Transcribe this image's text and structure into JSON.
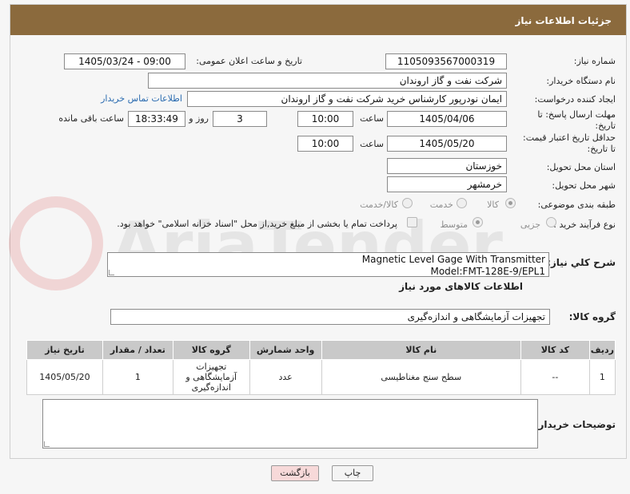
{
  "header": {
    "title": "جزئیات اطلاعات نیاز"
  },
  "fields": {
    "need_number_label": "شماره نیاز:",
    "need_number": "1105093567000319",
    "announce_label": "تاریخ و ساعت اعلان عمومی:",
    "announce_value": "1405/03/24 - 09:00",
    "buyer_org_label": "نام دستگاه خریدار:",
    "buyer_org": "شرکت نفت و گاز اروندان",
    "creator_label": "ایجاد کننده درخواست:",
    "creator": "ایمان نودرپور کارشناس خرید شرکت نفت و گاز اروندان",
    "contact_link": "اطلاعات تماس خریدار",
    "deadline_label_1": "مهلت ارسال پاسخ: تا",
    "deadline_label_2": "تاریخ:",
    "deadline_date": "1405/04/06",
    "time_label": "ساعت",
    "deadline_time": "10:00",
    "days_value": "3",
    "days_label": "روز و",
    "remaining_time": "18:33:49",
    "remaining_label": "ساعت باقی مانده",
    "validity_label_1": "حداقل تاریخ اعتبار قیمت:",
    "validity_label_2": "تا تاریخ:",
    "validity_date": "1405/05/20",
    "validity_time": "10:00",
    "province_label": "استان محل تحویل:",
    "province": "خوزستان",
    "city_label": "شهر محل تحویل:",
    "city": "خرمشهر",
    "category_label": "طبقه بندی موضوعی:",
    "category_options": [
      "کالا",
      "خدمت",
      "کالا/خدمت"
    ],
    "process_label": "نوع فرآیند خرید :",
    "process_options": [
      "جزیی",
      "متوسط"
    ],
    "payment_note": "پرداخت تمام یا بخشی از مبلغ خرید,از محل \"اسناد خزانه اسلامی\" خواهد بود.",
    "description_label": "شرح کلي نياز:",
    "description_line1": "Magnetic Level Gage With Transmitter",
    "description_line2": "Model:FMT-128E-9/EPL1",
    "goods_info_title": "اطلاعات کالاهای مورد نیاز",
    "goods_group_label": "گروه کالا:",
    "goods_group": "تجهیزات آزمایشگاهی و اندازه‌گیری",
    "buyer_notes_label": "توضیحات خریدار:"
  },
  "table": {
    "headers": [
      "ردیف",
      "کد کالا",
      "نام کالا",
      "واحد شمارش",
      "گروه کالا",
      "تعداد / مقدار",
      "تاریخ نیاز"
    ],
    "rows": [
      [
        "1",
        "--",
        "سطح سنج مغناطیسی",
        "عدد",
        "تجهیزات آزمایشگاهی و اندازه‌گیری",
        "1",
        "1405/05/20"
      ]
    ]
  },
  "buttons": {
    "print": "چاپ",
    "back": "بازگشت"
  },
  "watermark": "AriaTender.net",
  "colors": {
    "header_bg": "#8b6a3d",
    "back_button_bg": "#f7d9d9",
    "link": "#2a6bb0"
  }
}
